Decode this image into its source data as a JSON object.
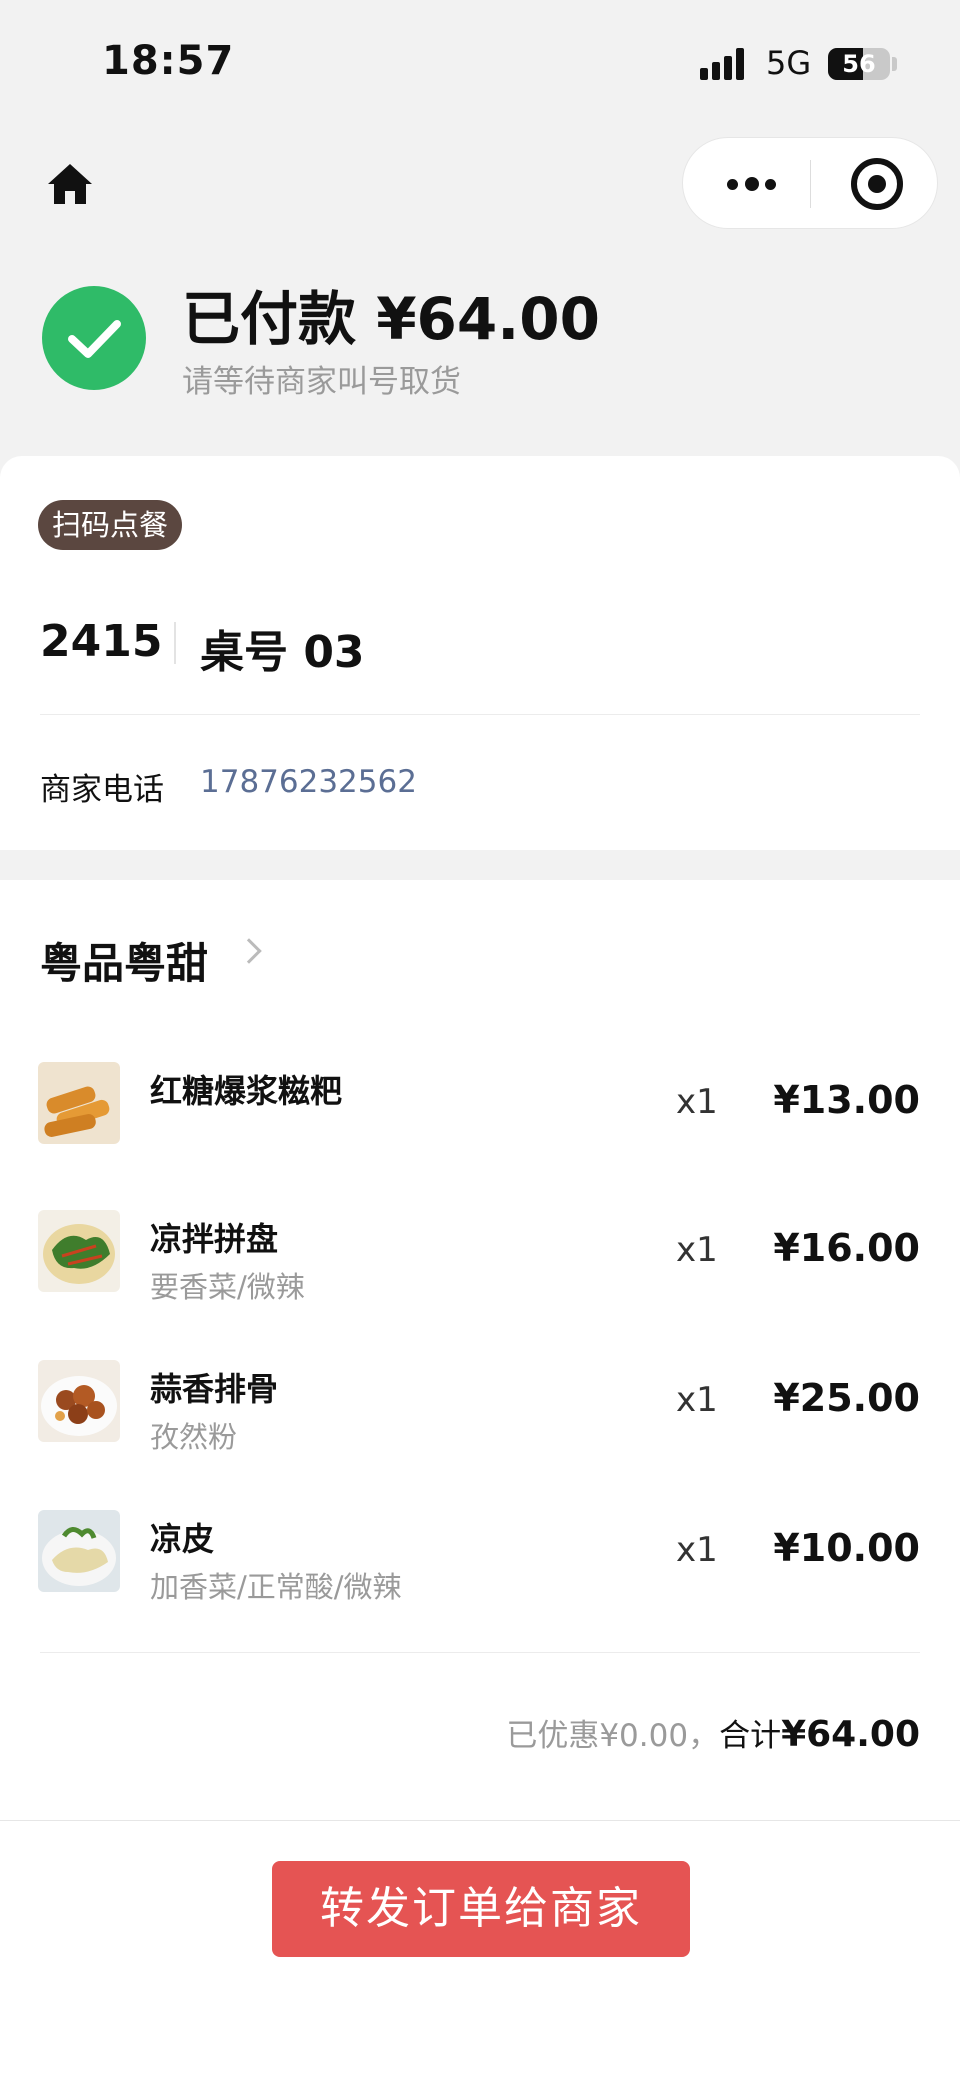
{
  "status_bar": {
    "time": "18:57",
    "network": "5G",
    "battery": "56",
    "battery_level": 0.56
  },
  "nav": {
    "home_icon": "home-icon",
    "more_icon": "more-dots-icon",
    "close_icon": "target-icon"
  },
  "header": {
    "title": "已付款 ¥64.00",
    "subtitle": "请等待商家叫号取货",
    "icon": "check-circle-icon",
    "icon_color": "#2fbb68"
  },
  "order": {
    "tag": "扫码点餐",
    "order_number": "2415",
    "table": "桌号 03",
    "phone_label": "商家电话",
    "phone": "17876232562"
  },
  "shop": {
    "name": "粤品粤甜"
  },
  "items": [
    {
      "name": "红糖爆浆糍粑",
      "options": "",
      "qty": "x1",
      "price": "¥13.00"
    },
    {
      "name": "凉拌拼盘",
      "options": "要香菜/微辣",
      "qty": "x1",
      "price": "¥16.00"
    },
    {
      "name": "蒜香排骨",
      "options": "孜然粉",
      "qty": "x1",
      "price": "¥25.00"
    },
    {
      "name": "凉皮",
      "options": "加香菜/正常酸/微辣",
      "qty": "x1",
      "price": "¥10.00"
    }
  ],
  "summary": {
    "discount": "已优惠¥0.00，",
    "total_label": "合计",
    "total": "¥64.00"
  },
  "footer": {
    "button": "转发订单给商家",
    "button_color": "#e55453"
  }
}
